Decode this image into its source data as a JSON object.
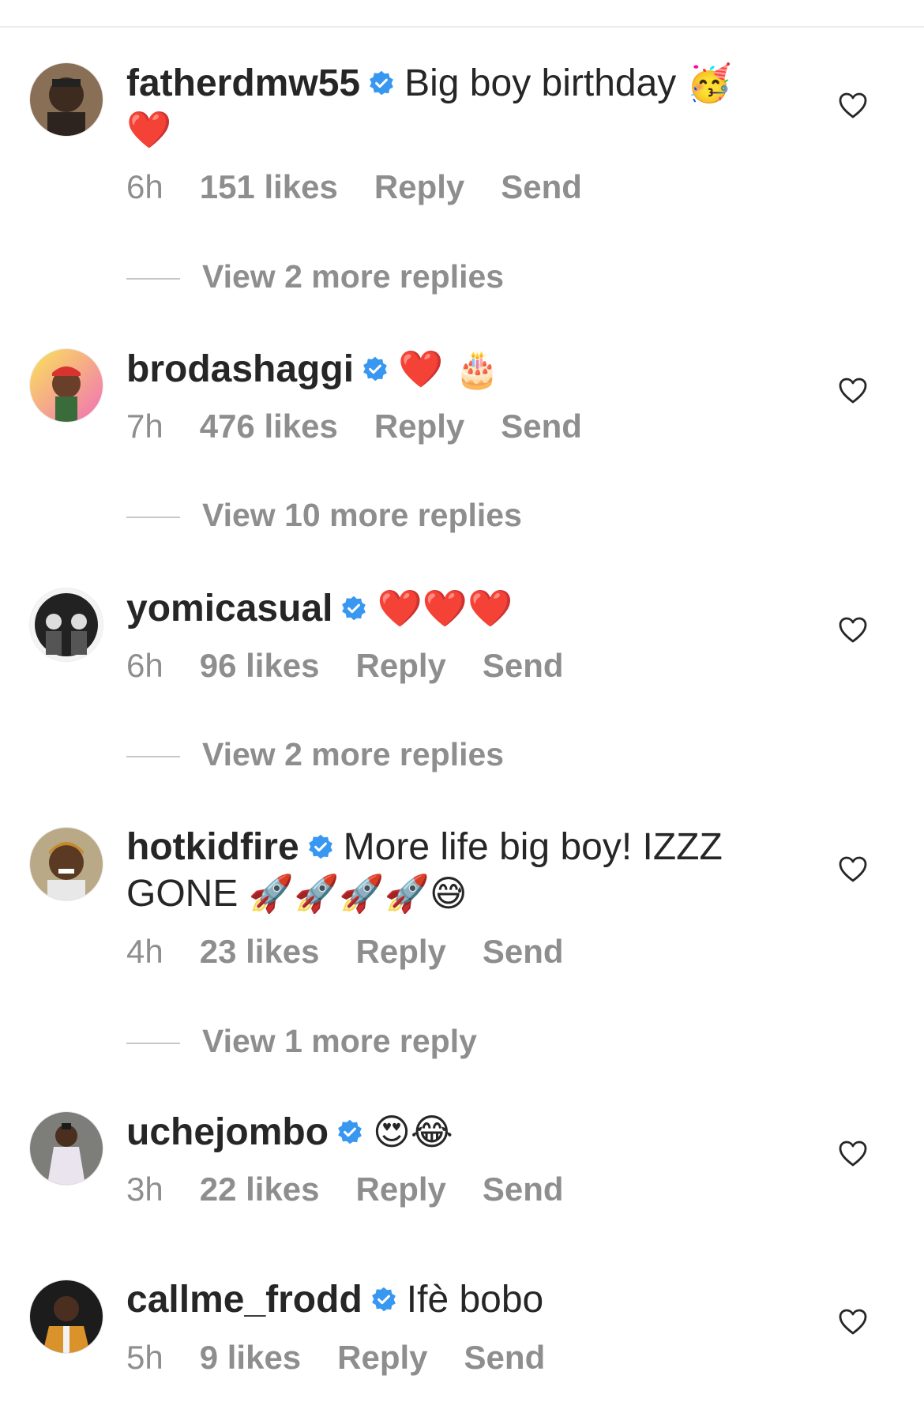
{
  "comments": [
    {
      "username": "fatherdmw55",
      "text": "Big boy birthday",
      "emojis": "🥳 ❤️",
      "time": "6h",
      "likes": "151 likes",
      "reply": "Reply",
      "send": "Send",
      "view_replies": "View 2 more replies"
    },
    {
      "username": "brodashaggi",
      "text": "",
      "emojis": "❤️ 🎂",
      "time": "7h",
      "likes": "476 likes",
      "reply": "Reply",
      "send": "Send",
      "view_replies": "View 10 more replies"
    },
    {
      "username": "yomicasual",
      "text": "",
      "emojis": "❤️❤️❤️",
      "time": "6h",
      "likes": "96 likes",
      "reply": "Reply",
      "send": "Send",
      "view_replies": "View 2 more replies"
    },
    {
      "username": "hotkidfire",
      "text": "More life big boy! IZZZ GONE",
      "emojis": "🚀🚀🚀🚀😅",
      "time": "4h",
      "likes": "23 likes",
      "reply": "Reply",
      "send": "Send",
      "view_replies": "View 1 more reply"
    },
    {
      "username": "uchejombo",
      "text": "",
      "emojis": "😍😂",
      "time": "3h",
      "likes": "22 likes",
      "reply": "Reply",
      "send": "Send",
      "view_replies": ""
    },
    {
      "username": "callme_frodd",
      "text": "Ifè bobo",
      "emojis": "",
      "time": "5h",
      "likes": "9 likes",
      "reply": "Reply",
      "send": "Send",
      "view_replies": ""
    }
  ],
  "icons": {
    "verified": "verified-badge-icon",
    "like": "heart-outline-icon"
  },
  "colors": {
    "verified_blue": "#3897f0",
    "text_primary": "#262626",
    "text_secondary": "#8e8e8e"
  }
}
